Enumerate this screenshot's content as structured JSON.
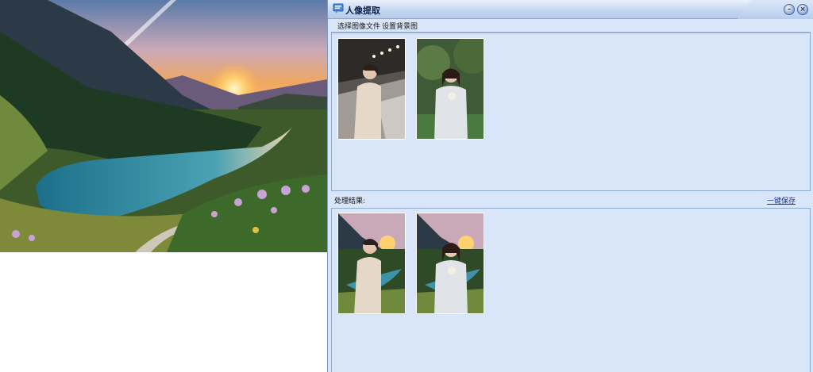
{
  "window": {
    "title": "人像提取",
    "minimize_label": "–",
    "close_label": "×"
  },
  "toolbar": {
    "select_image_label": "选择图像文件",
    "set_background_label": "设置背景图"
  },
  "results": {
    "label": "处理结果:",
    "save_all_label": "一键保存"
  },
  "colors": {
    "window_bg": "#d9e5f8",
    "border": "#8ea9cf",
    "link": "#1a33a0"
  },
  "icons": {
    "title": "chat-window-icon",
    "minimize": "minimize-icon",
    "close": "close-icon"
  }
}
